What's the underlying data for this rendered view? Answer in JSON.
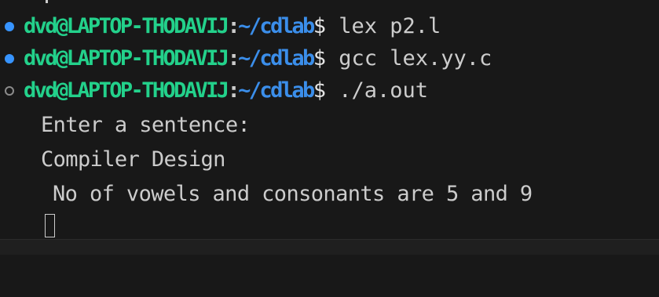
{
  "colors": {
    "background": "#181818",
    "user_host": "#23d18b",
    "path": "#3b8eea",
    "text": "#cccccc",
    "success_decoration": "#3794ff",
    "idle_decoration": "#8b8b8b"
  },
  "terminal": {
    "commands": [
      {
        "decoration": "success-circle-icon",
        "user_host": "dvd@LAPTOP-THODAVIJ",
        "separator": ":",
        "path": "~/cdlab",
        "symbol": "$",
        "command": " lex p2.l"
      },
      {
        "decoration": "success-circle-icon",
        "user_host": "dvd@LAPTOP-THODAVIJ",
        "separator": ":",
        "path": "~/cdlab",
        "symbol": "$",
        "command": " gcc lex.yy.c"
      },
      {
        "decoration": "idle-circle-icon",
        "user_host": "dvd@LAPTOP-THODAVIJ",
        "separator": ":",
        "path": "~/cdlab",
        "symbol": "$",
        "command": " ./a.out"
      }
    ],
    "output": [
      "Enter a sentence:",
      "Compiler Design",
      "No of vowels and consonants are 5 and 9"
    ]
  }
}
